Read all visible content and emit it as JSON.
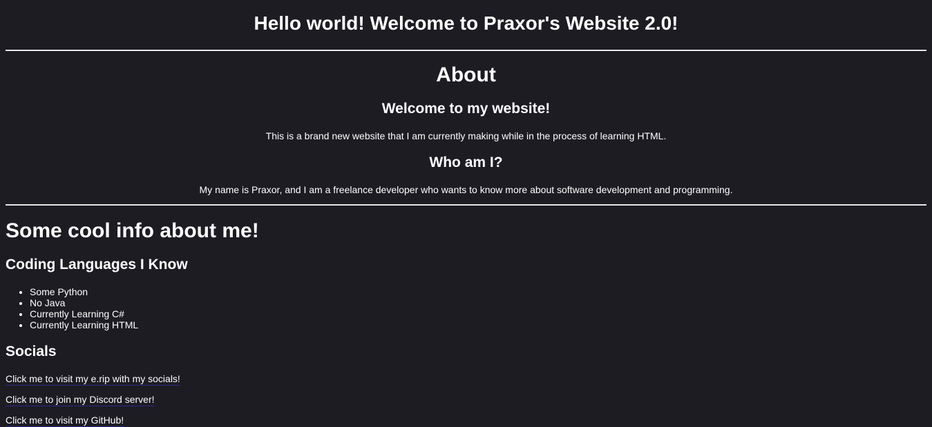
{
  "header": {
    "title": "Hello world! Welcome to Praxor's Website 2.0!"
  },
  "about": {
    "heading": "About",
    "welcome_heading": "Welcome to my website!",
    "welcome_text": "This is a brand new website that I am currently making while in the process of learning HTML.",
    "who_heading": "Who am I?",
    "who_text": "My name is Praxor, and I am a freelance developer who wants to know more about software development and programming."
  },
  "info": {
    "heading": "Some cool info about me!",
    "languages_heading": "Coding Languages I Know",
    "languages": [
      "Some Python",
      "No Java",
      "Currently Learning C#",
      "Currently Learning HTML"
    ]
  },
  "socials": {
    "heading": "Socials",
    "links": [
      "Click me to visit my e.rip with my socials!",
      "Click me to join my Discord server!",
      "Click me to visit my GitHub!"
    ]
  },
  "colors": {
    "background": "#1d1c23",
    "text": "#ffffff",
    "rule": "#e6e6e6",
    "link_underline": "#2a2a8a"
  }
}
